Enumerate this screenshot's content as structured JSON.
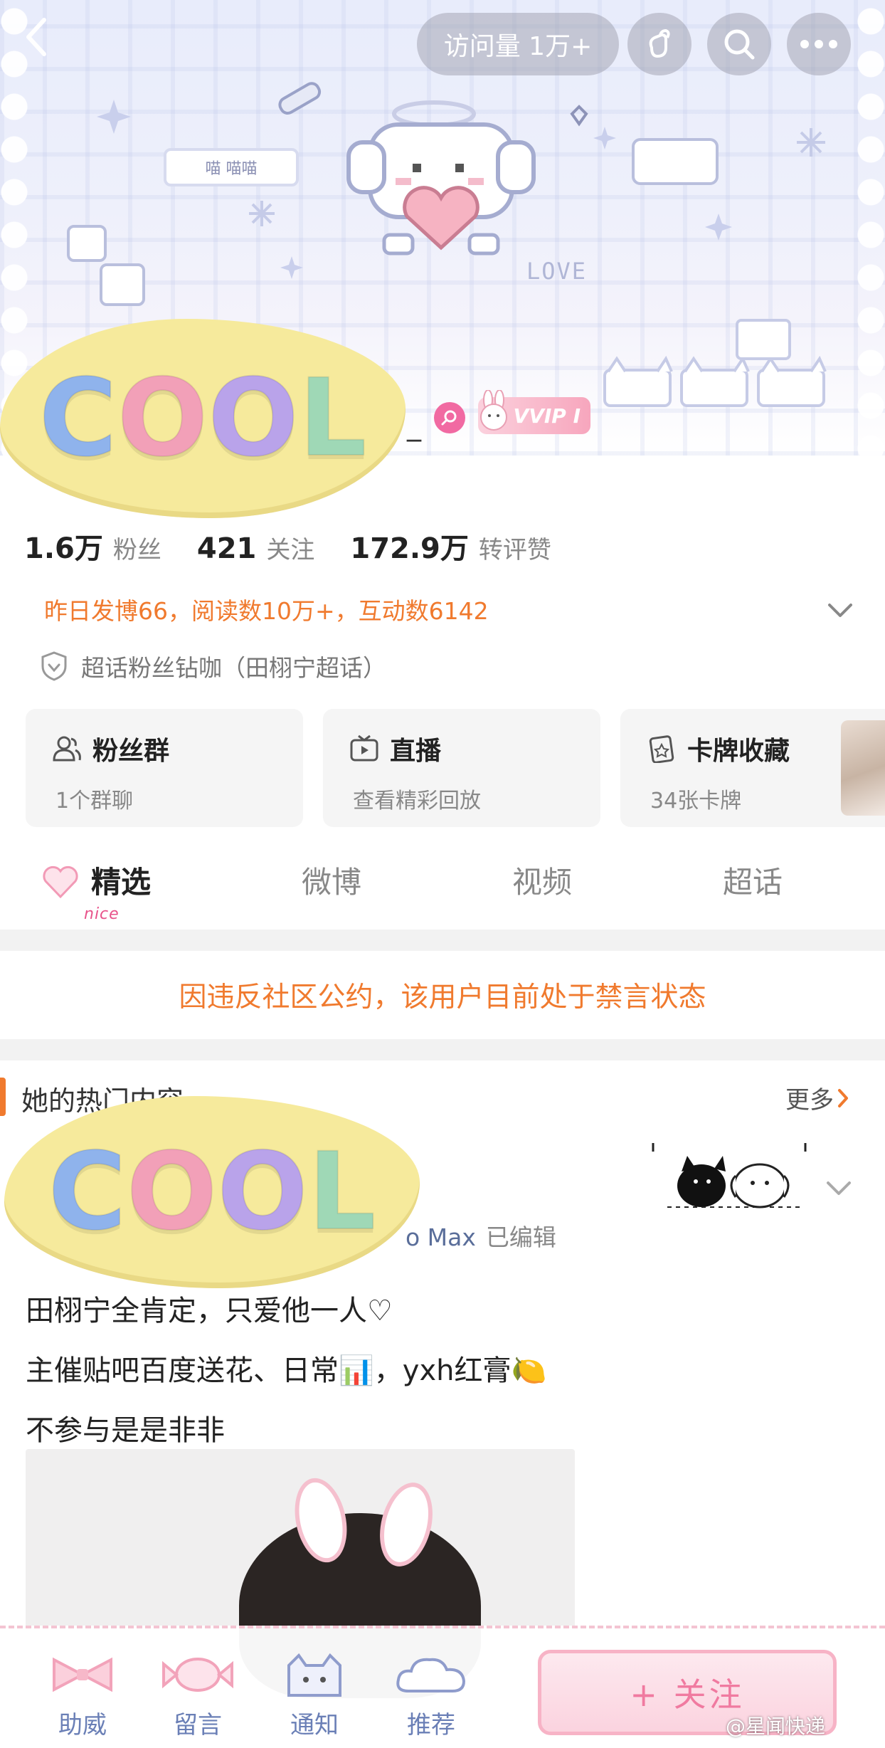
{
  "header": {
    "visits_label": "访问量 1万+",
    "banner_tag": "喵 喵喵",
    "banner_word": "LOVE"
  },
  "stickers": {
    "cool_text": [
      "C",
      "O",
      "O",
      "L"
    ],
    "cool_colors": [
      "#8fb3ec",
      "#f2a0b8",
      "#b9a3ea",
      "#9fd8b6"
    ]
  },
  "profile": {
    "name_suffix": "_",
    "vip_label": "VVIP I"
  },
  "stats": [
    {
      "num": "1.6万",
      "label": "粉丝"
    },
    {
      "num": "421",
      "label": "关注"
    },
    {
      "num": "172.9万",
      "label": "转评赞"
    }
  ],
  "daily_summary": "昨日发博66，阅读数10万+，互动数6142",
  "supertopic": "超话粉丝钻咖（田栩宁超话）",
  "cards": [
    {
      "title": "粉丝群",
      "sub": "1个群聊",
      "icon": "group-icon"
    },
    {
      "title": "直播",
      "sub": "查看精彩回放",
      "icon": "tv-icon"
    },
    {
      "title": "卡牌收藏",
      "sub": "34张卡牌",
      "icon": "card-icon"
    }
  ],
  "tabs": {
    "items": [
      "精选",
      "微博",
      "视频",
      "超话"
    ],
    "active_badge": "nice"
  },
  "ban_notice": "因违反社区公约，该用户目前处于禁言状态",
  "hot_section": {
    "title": "她的热门内容",
    "more": "更多"
  },
  "post": {
    "device_partial": "o Max",
    "edited": "已编辑",
    "lines": [
      "田栩宁全肯定，只爱他一人♡",
      "主催贴吧百度送花、日常📊，yxh红膏🍋",
      "不参与是是非非"
    ]
  },
  "bottom_bar": {
    "items": [
      "助威",
      "留言",
      "通知",
      "推荐"
    ],
    "follow": "+ 关注"
  },
  "watermark": "@星闻快递",
  "colors": {
    "accent_orange": "#f07a2e",
    "link_blue": "#5a6e9a",
    "pink": "#f07aa0"
  }
}
